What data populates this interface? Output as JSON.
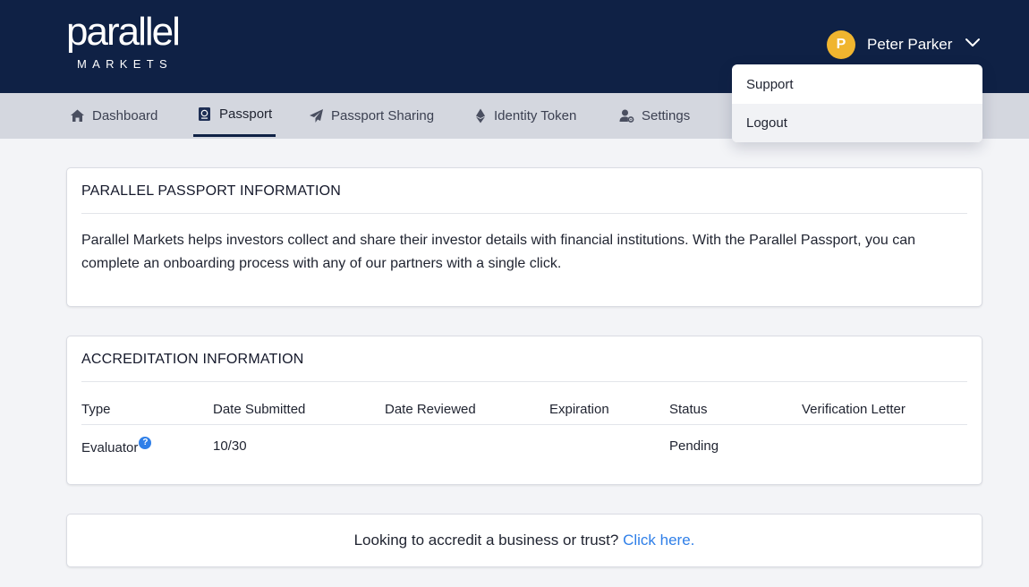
{
  "header": {
    "logo_word": "parallel",
    "logo_sub": "MARKETS",
    "user": {
      "initial": "P",
      "name": "Peter Parker",
      "avatar_color": "#f0b52f"
    }
  },
  "dropdown": {
    "items": [
      "Support",
      "Logout"
    ]
  },
  "nav": {
    "tabs": [
      {
        "label": "Dashboard",
        "icon": "home-icon"
      },
      {
        "label": "Passport",
        "icon": "passport-icon"
      },
      {
        "label": "Passport Sharing",
        "icon": "paper-plane-icon"
      },
      {
        "label": "Identity Token",
        "icon": "ethereum-icon"
      },
      {
        "label": "Settings",
        "icon": "user-cog-icon"
      }
    ]
  },
  "passport_info": {
    "title": "PARALLEL PASSPORT INFORMATION",
    "body": "Parallel Markets helps investors collect and share their investor details with financial institutions. With the Parallel Passport, you can complete an onboarding process with any of our partners with a single click."
  },
  "accreditation": {
    "title": "ACCREDITATION INFORMATION",
    "columns": [
      "Type",
      "Date Submitted",
      "Date Reviewed",
      "Expiration",
      "Status",
      "Verification Letter"
    ],
    "rows": [
      {
        "type": "Evaluator",
        "help": "?",
        "date_submitted": "10/30",
        "date_reviewed": "",
        "expiration": "",
        "status": "Pending",
        "verification_letter": ""
      }
    ]
  },
  "cta": {
    "text": "Looking to accredit a business or trust?",
    "link": "Click here."
  },
  "colors": {
    "header_bg": "#0f2145",
    "nav_bg": "#d4d7df",
    "link": "#2f7fe8",
    "accent": "#f0b52f"
  }
}
